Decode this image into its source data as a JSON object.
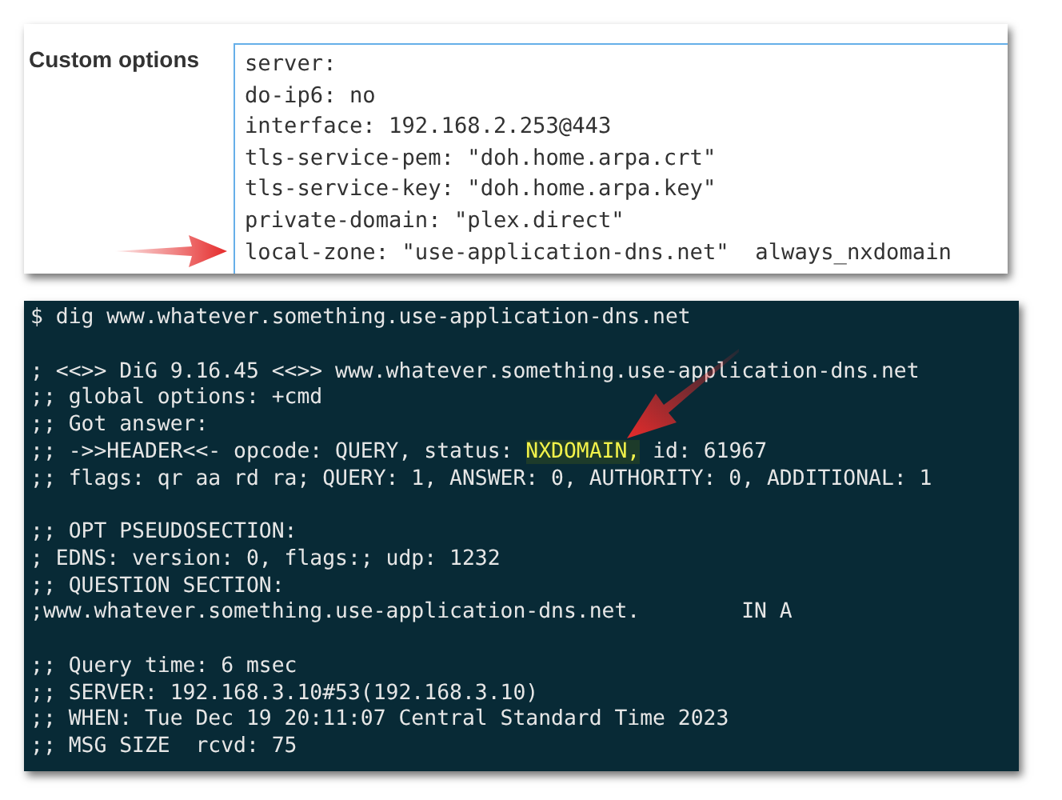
{
  "settings_panel": {
    "label": "Custom options",
    "config_lines": [
      "server:",
      "do-ip6: no",
      "interface: 192.168.2.253@443",
      "tls-service-pem: \"doh.home.arpa.crt\"",
      "tls-service-key: \"doh.home.arpa.key\"",
      "private-domain: \"plex.direct\"",
      "local-zone: \"use-application-dns.net\"  always_nxdomain"
    ]
  },
  "terminal": {
    "lines": [
      {
        "kind": "text",
        "parts": [
          {
            "text": "$ dig www.whatever.something.use-application-dns.net",
            "highlighted": false
          }
        ]
      },
      {
        "kind": "blank"
      },
      {
        "kind": "text",
        "parts": [
          {
            "text": "; <<>> DiG 9.16.45 <<>> www.whatever.something.use-application-dns.net",
            "highlighted": false
          }
        ]
      },
      {
        "kind": "text",
        "parts": [
          {
            "text": ";; global options: +cmd",
            "highlighted": false
          }
        ]
      },
      {
        "kind": "text",
        "parts": [
          {
            "text": ";; Got answer:",
            "highlighted": false
          }
        ]
      },
      {
        "kind": "text",
        "parts": [
          {
            "text": ";; ->>HEADER<<- opcode: QUERY, status: ",
            "highlighted": false
          },
          {
            "text": "NXDOMAIN,",
            "highlighted": true
          },
          {
            "text": " id: 61967",
            "highlighted": false
          }
        ]
      },
      {
        "kind": "text",
        "parts": [
          {
            "text": ";; flags: qr aa rd ra; QUERY: 1, ANSWER: 0, AUTHORITY: 0, ADDITIONAL: 1",
            "highlighted": false
          }
        ]
      },
      {
        "kind": "blank"
      },
      {
        "kind": "text",
        "parts": [
          {
            "text": ";; OPT PSEUDOSECTION:",
            "highlighted": false
          }
        ]
      },
      {
        "kind": "text",
        "parts": [
          {
            "text": "; EDNS: version: 0, flags:; udp: 1232",
            "highlighted": false
          }
        ]
      },
      {
        "kind": "text",
        "parts": [
          {
            "text": ";; QUESTION SECTION:",
            "highlighted": false
          }
        ]
      },
      {
        "kind": "text",
        "parts": [
          {
            "text": ";www.whatever.something.use-application-dns.net.        IN A",
            "highlighted": false
          }
        ]
      },
      {
        "kind": "blank"
      },
      {
        "kind": "text",
        "parts": [
          {
            "text": ";; Query time: 6 msec",
            "highlighted": false
          }
        ]
      },
      {
        "kind": "text",
        "parts": [
          {
            "text": ";; SERVER: 192.168.3.10#53(192.168.3.10)",
            "highlighted": false
          }
        ]
      },
      {
        "kind": "text",
        "parts": [
          {
            "text": ";; WHEN: Tue Dec 19 20:11:07 Central Standard Time 2023",
            "highlighted": false
          }
        ]
      },
      {
        "kind": "text",
        "parts": [
          {
            "text": ";; MSG SIZE  rcvd: 75",
            "highlighted": false
          }
        ]
      }
    ]
  }
}
